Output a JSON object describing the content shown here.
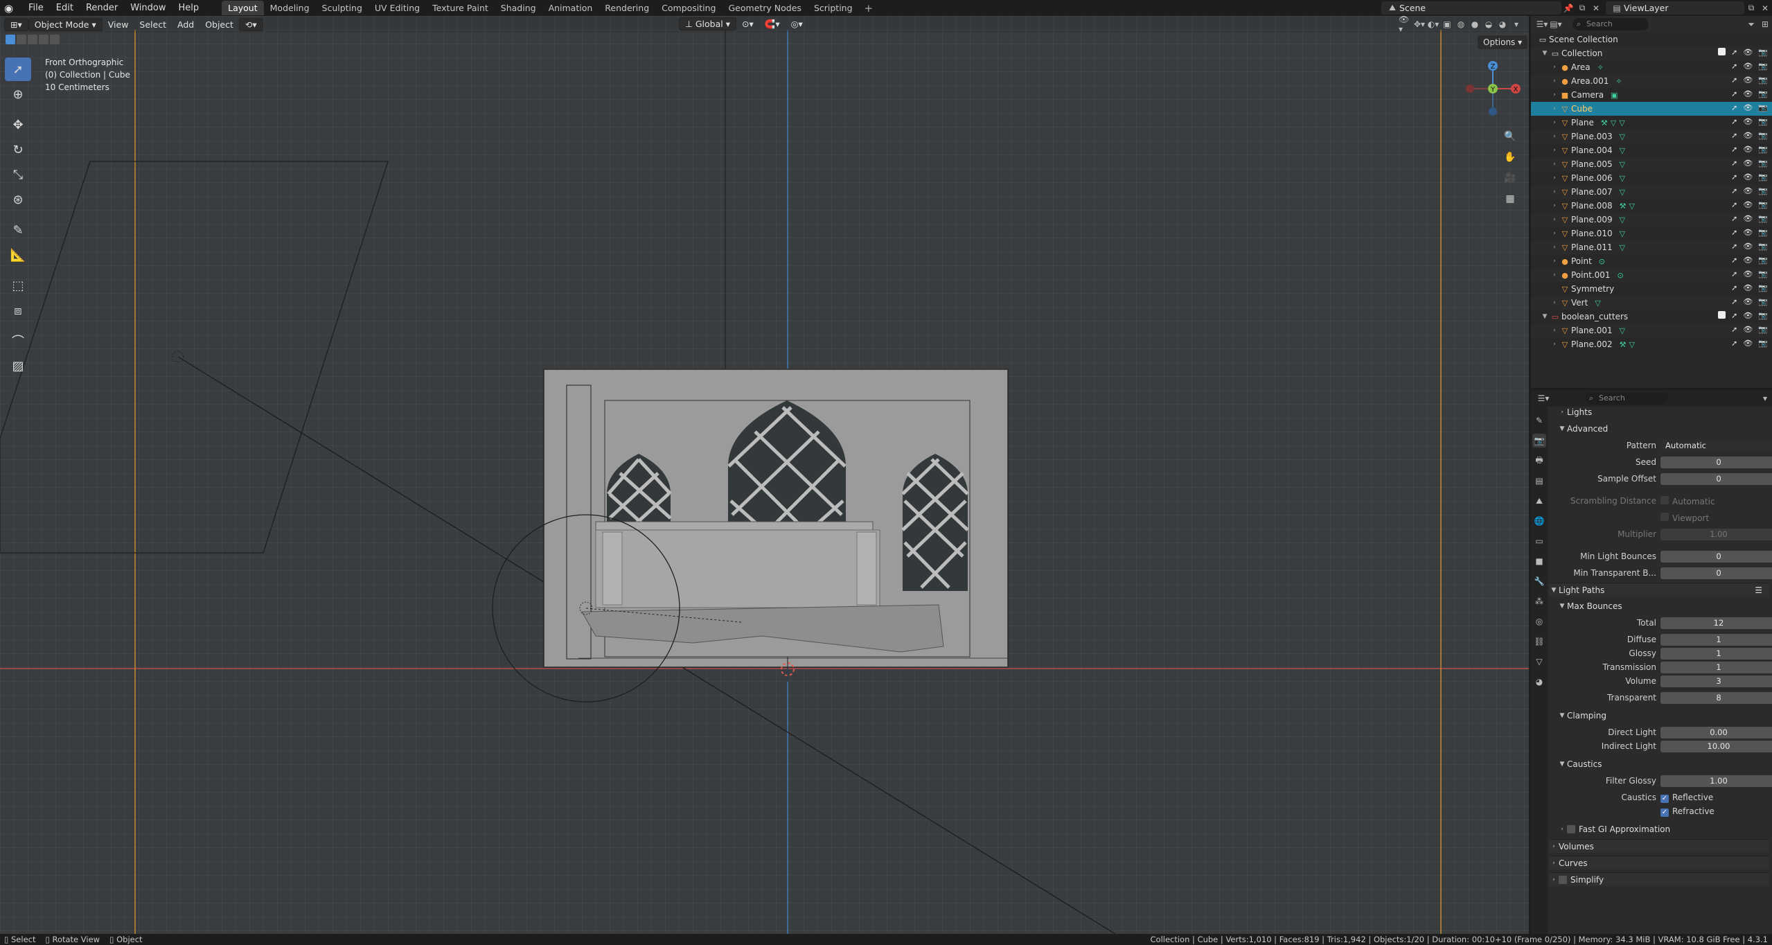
{
  "menu": {
    "file": "File",
    "edit": "Edit",
    "render": "Render",
    "window": "Window",
    "help": "Help"
  },
  "workspaces": [
    "Layout",
    "Modeling",
    "Sculpting",
    "UV Editing",
    "Texture Paint",
    "Shading",
    "Animation",
    "Rendering",
    "Compositing",
    "Geometry Nodes",
    "Scripting"
  ],
  "scene": "Scene",
  "view_layer": "ViewLayer",
  "viewport_header": {
    "mode": "Object Mode",
    "view": "View",
    "select": "Select",
    "add": "Add",
    "object": "Object",
    "orientation": "Global",
    "options": "Options"
  },
  "overlay": {
    "view_name": "Front Orthographic",
    "collection": "(0) Collection | Cube",
    "scale": "10 Centimeters"
  },
  "gizmo": {
    "z": "Z",
    "y": "Y",
    "x": "X"
  },
  "outliner": {
    "search_placeholder": "Search",
    "rows": [
      {
        "name": "Scene Collection",
        "icon": "collection",
        "level": 0
      },
      {
        "name": "Collection",
        "icon": "collection",
        "level": 1
      },
      {
        "name": "Area",
        "icon": "light",
        "level": 2
      },
      {
        "name": "Area.001",
        "icon": "light",
        "level": 2
      },
      {
        "name": "Camera",
        "icon": "camera",
        "level": 2
      },
      {
        "name": "Cube",
        "icon": "mesh",
        "level": 2
      },
      {
        "name": "Plane",
        "icon": "mesh",
        "level": 2
      },
      {
        "name": "Plane.003",
        "icon": "mesh",
        "level": 2
      },
      {
        "name": "Plane.004",
        "icon": "mesh",
        "level": 2
      },
      {
        "name": "Plane.005",
        "icon": "mesh",
        "level": 2
      },
      {
        "name": "Plane.006",
        "icon": "mesh",
        "level": 2
      },
      {
        "name": "Plane.007",
        "icon": "mesh",
        "level": 2
      },
      {
        "name": "Plane.008",
        "icon": "mesh",
        "level": 2
      },
      {
        "name": "Plane.009",
        "icon": "mesh",
        "level": 2
      },
      {
        "name": "Plane.010",
        "icon": "mesh",
        "level": 2
      },
      {
        "name": "Plane.011",
        "icon": "mesh",
        "level": 2
      },
      {
        "name": "Point",
        "icon": "light",
        "level": 2
      },
      {
        "name": "Point.001",
        "icon": "light",
        "level": 2
      },
      {
        "name": "Symmetry",
        "icon": "mesh",
        "level": 2
      },
      {
        "name": "Vert",
        "icon": "mesh",
        "level": 2
      },
      {
        "name": "boolean_cutters",
        "icon": "collection",
        "level": 1
      },
      {
        "name": "Plane.001",
        "icon": "mesh",
        "level": 2
      },
      {
        "name": "Plane.002",
        "icon": "mesh",
        "level": 2
      }
    ]
  },
  "properties": {
    "search_placeholder": "Search",
    "lights": "Lights",
    "advanced": "Advanced",
    "pattern_label": "Pattern",
    "pattern_value": "Automatic",
    "seed_label": "Seed",
    "seed_value": "0",
    "sample_offset_label": "Sample Offset",
    "sample_offset_value": "0",
    "scrambling_label": "Scrambling Distance",
    "automatic": "Automatic",
    "viewport": "Viewport",
    "multiplier_label": "Multiplier",
    "multiplier_value": "1.00",
    "min_light_bounces_label": "Min Light Bounces",
    "min_light_bounces_value": "0",
    "min_transparent_label": "Min Transparent B...",
    "min_transparent_value": "0",
    "light_paths": "Light Paths",
    "max_bounces": "Max Bounces",
    "total_label": "Total",
    "total_value": "12",
    "diffuse_label": "Diffuse",
    "diffuse_value": "1",
    "glossy_label": "Glossy",
    "glossy_value": "1",
    "transmission_label": "Transmission",
    "transmission_value": "1",
    "volume_label": "Volume",
    "volume_value": "3",
    "transparent_label": "Transparent",
    "transparent_value": "8",
    "clamping": "Clamping",
    "direct_light_label": "Direct Light",
    "direct_light_value": "0.00",
    "indirect_light_label": "Indirect Light",
    "indirect_light_value": "10.00",
    "caustics": "Caustics",
    "filter_glossy_label": "Filter Glossy",
    "filter_glossy_value": "1.00",
    "caustics_label": "Caustics",
    "reflective": "Reflective",
    "refractive": "Refractive",
    "fast_gi": "Fast GI Approximation",
    "volumes": "Volumes",
    "curves": "Curves",
    "simplify": "Simplify"
  },
  "statusbar": {
    "select": "Select",
    "rotate": "Rotate View",
    "object": "Object",
    "stats": "Collection | Cube | Verts:1,010 | Faces:819 | Tris:1,942 | Objects:1/20 | Duration: 00:10+10 (Frame 0/250) | Memory: 34.3 MiB | VRAM: 10.8 GiB Free | 4.3.1"
  },
  "colors": {
    "accent": "#4772b3",
    "selected_row": "#1f7f9e",
    "x_axis": "#d04545",
    "y_axis": "#8bc34a",
    "z_axis": "#4a8fd6"
  }
}
